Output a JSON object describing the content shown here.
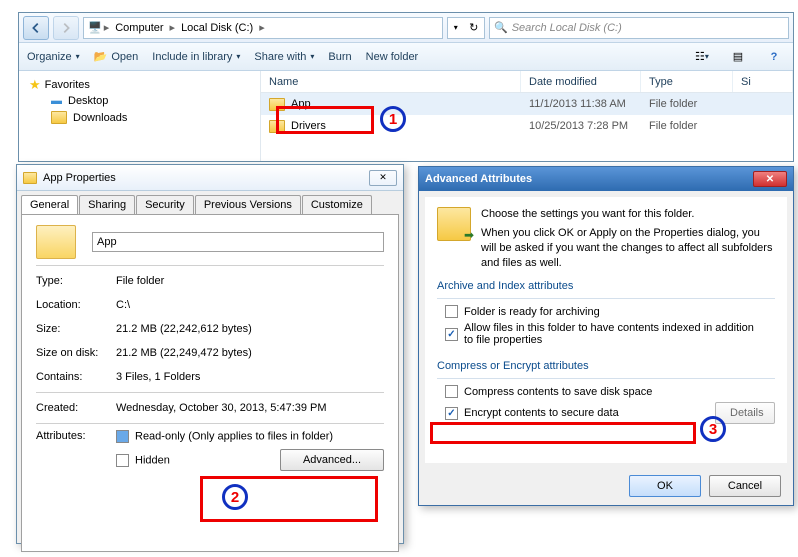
{
  "explorer": {
    "breadcrumb": [
      "Computer",
      "Local Disk (C:)"
    ],
    "search_placeholder": "Search Local Disk (C:)",
    "toolbar": {
      "organize": "Organize",
      "open": "Open",
      "include": "Include in library",
      "share": "Share with",
      "burn": "Burn",
      "newfolder": "New folder"
    },
    "nav": {
      "favorites": "Favorites",
      "desktop": "Desktop",
      "downloads": "Downloads"
    },
    "columns": {
      "name": "Name",
      "date": "Date modified",
      "type": "Type",
      "size": "Si"
    },
    "rows": [
      {
        "name": "App",
        "date": "11/1/2013 11:38 AM",
        "type": "File folder"
      },
      {
        "name": "Drivers",
        "date": "10/25/2013 7:28 PM",
        "type": "File folder"
      }
    ]
  },
  "props": {
    "title": "App Properties",
    "tabs": [
      "General",
      "Sharing",
      "Security",
      "Previous Versions",
      "Customize"
    ],
    "name": "App",
    "type_label": "Type:",
    "type": "File folder",
    "location_label": "Location:",
    "location": "C:\\",
    "size_label": "Size:",
    "size": "21.2 MB (22,242,612 bytes)",
    "sizedisk_label": "Size on disk:",
    "sizedisk": "21.2 MB (22,249,472 bytes)",
    "contains_label": "Contains:",
    "contains": "3 Files, 1 Folders",
    "created_label": "Created:",
    "created": "Wednesday, October 30, 2013, 5:47:39 PM",
    "attributes_label": "Attributes:",
    "readonly": "Read-only (Only applies to files in folder)",
    "hidden": "Hidden",
    "advanced_btn": "Advanced..."
  },
  "adv": {
    "title": "Advanced Attributes",
    "intro1": "Choose the settings you want for this folder.",
    "intro2": "When you click OK or Apply on the Properties dialog, you will be asked if you want the changes to affect all subfolders and files as well.",
    "group1": "Archive and Index attributes",
    "archive": "Folder is ready for archiving",
    "index": "Allow files in this folder to have contents indexed in addition to file properties",
    "group2": "Compress or Encrypt attributes",
    "compress": "Compress contents to save disk space",
    "encrypt": "Encrypt contents to secure data",
    "details_btn": "Details",
    "ok": "OK",
    "cancel": "Cancel"
  },
  "callouts": {
    "n1": "1",
    "n2": "2",
    "n3": "3"
  }
}
